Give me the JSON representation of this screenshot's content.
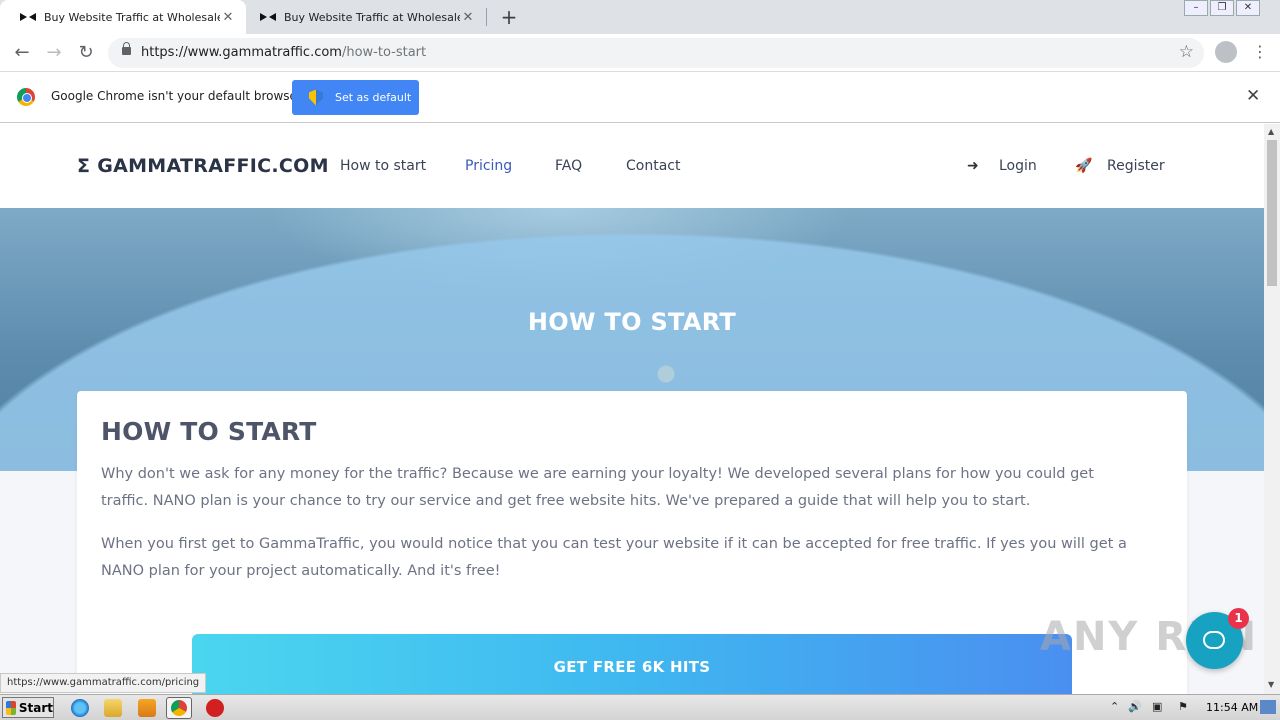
{
  "browser": {
    "tabs": [
      {
        "title": "Buy Website Traffic at Wholesale Ra",
        "active": true
      },
      {
        "title": "Buy Website Traffic at Wholesale Ra",
        "active": false
      }
    ],
    "new_tab_glyph": "+",
    "url_host": "https://www.gammatraffic.com",
    "url_path": "/how-to-start",
    "infobar": {
      "message": "Google Chrome isn't your default browser",
      "button": "Set as default"
    },
    "status_url": "https://www.gammatraffic.com/pricing"
  },
  "site": {
    "logo": "Σ GAMMATRAFFIC.COM",
    "nav": [
      "How to start",
      "Pricing",
      "FAQ",
      "Contact"
    ],
    "login": "Login",
    "register": "Register",
    "hero_title": "HOW TO START",
    "card_title": "HOW TO START",
    "paragraph1": "Why don't we ask for any money for the traffic? Because we are earning your loyalty! We developed several plans for how you could get traffic. NANO plan is your chance to try our service and get free website hits. We've prepared a guide that will help you to start.",
    "paragraph2": "When you first get to GammaTraffic, you would notice that you can test your website if it can be accepted for free traffic. If yes you will get a NANO plan for your project automatically. And it's free!",
    "cta": "GET FREE 6K HITS",
    "chat_badge": "1"
  },
  "watermark": "ANY RUN",
  "taskbar": {
    "start": "Start",
    "clock": "11:54 AM"
  },
  "colors": {
    "nav_active": "#3b5bbd",
    "infobar_button": "#4285f4",
    "cta_start": "#4bd6ef",
    "cta_end": "#4a8ff0",
    "chat": "#17a2c1",
    "badge": "#e8334a"
  }
}
